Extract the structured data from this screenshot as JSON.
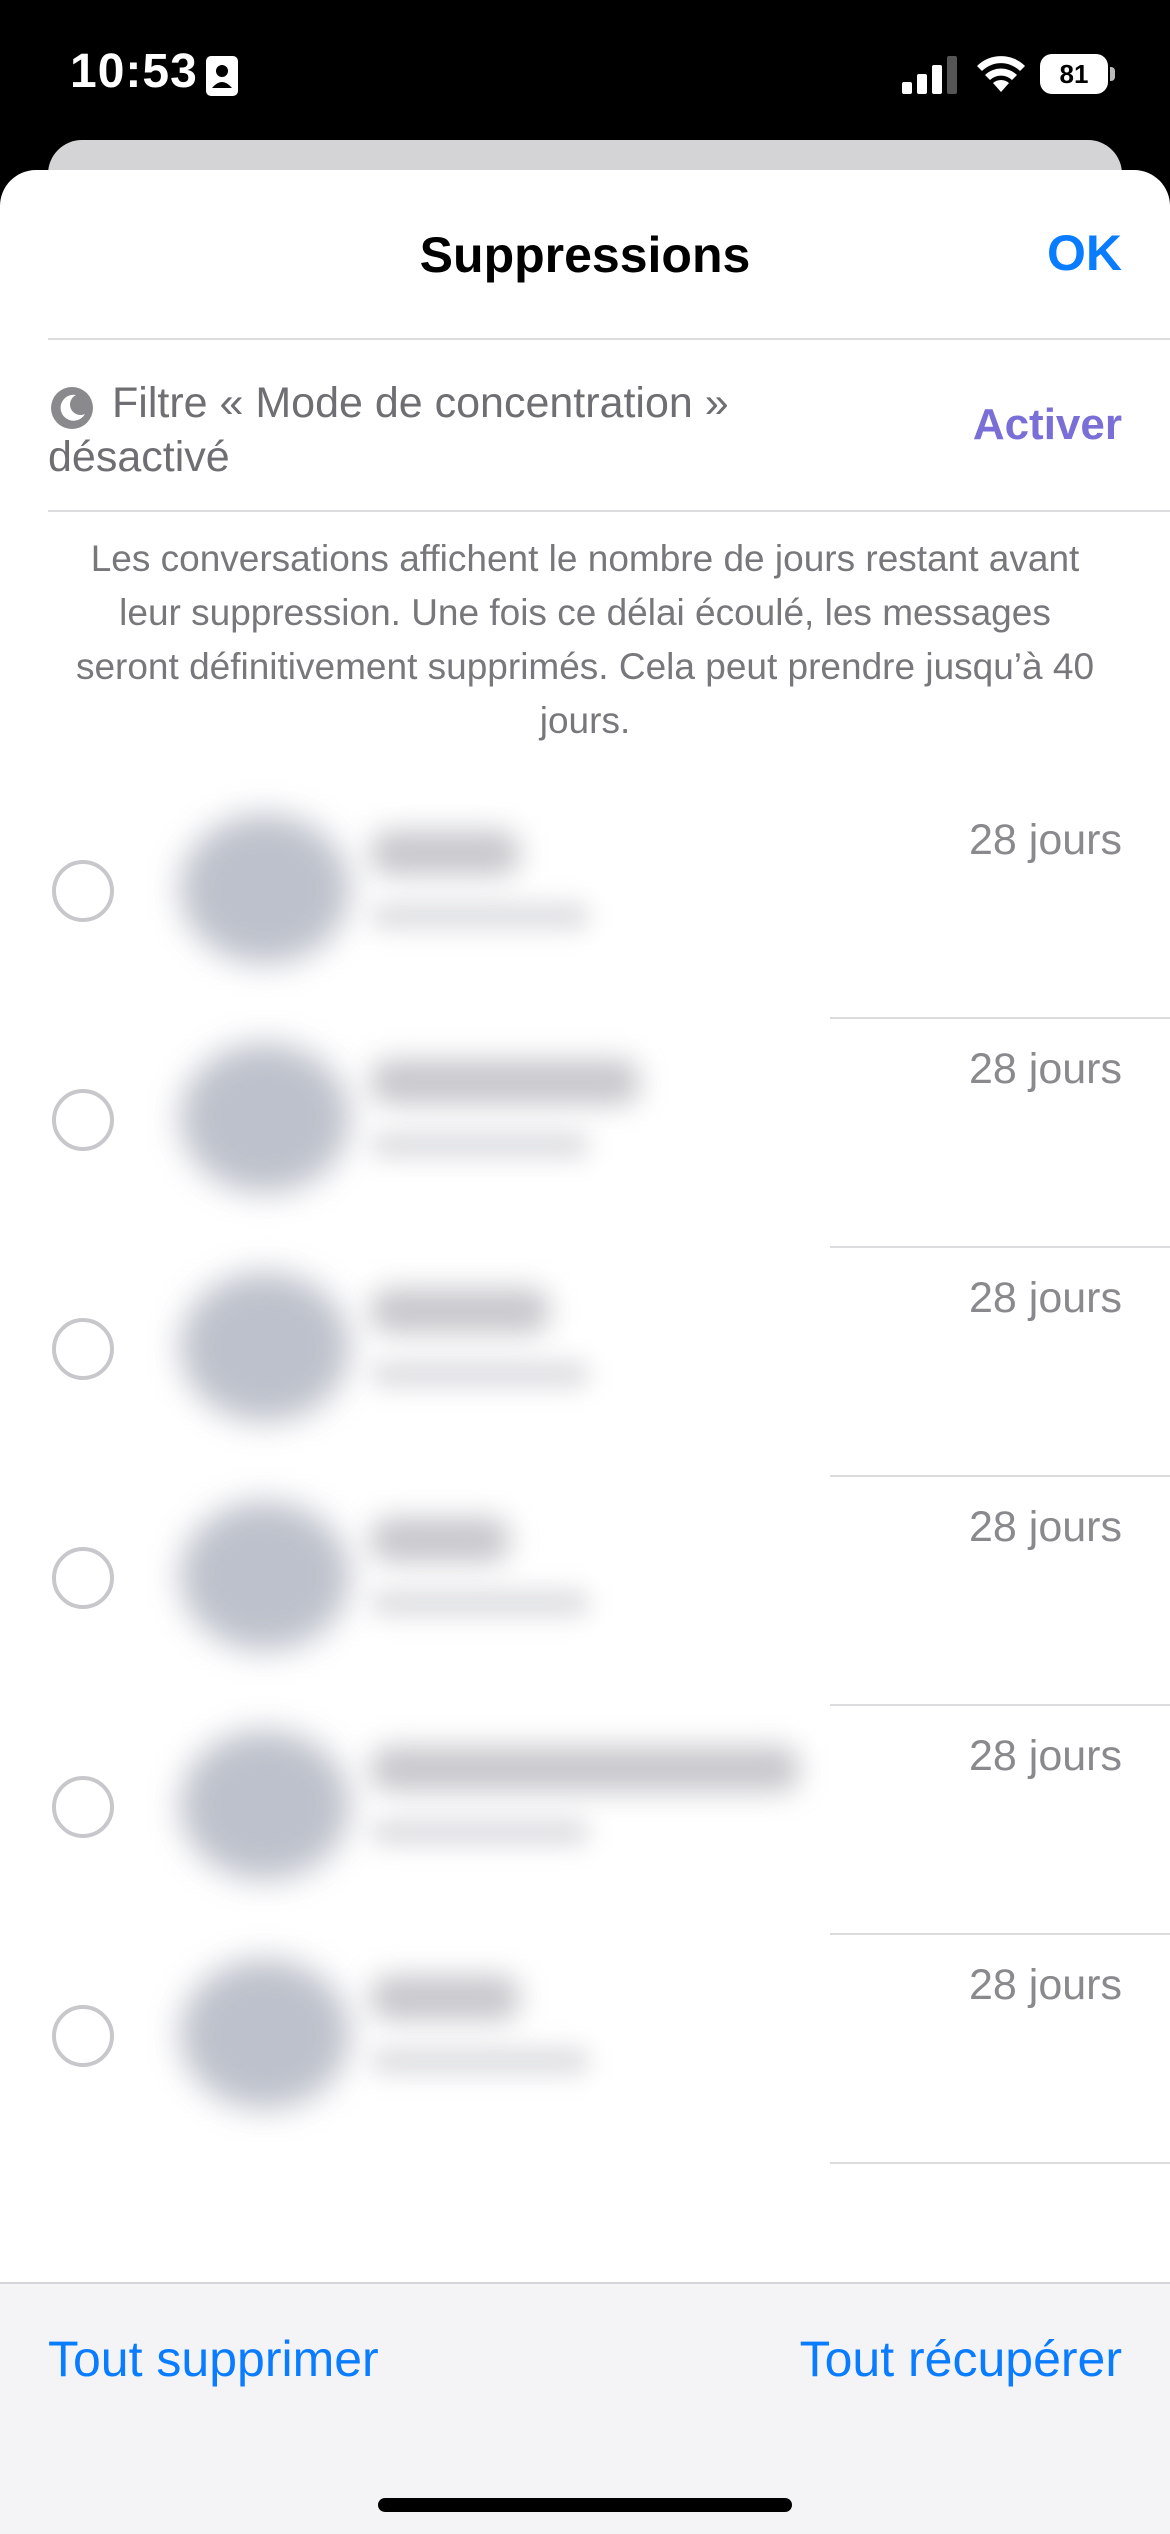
{
  "status_bar": {
    "time": "10:53",
    "battery": "81"
  },
  "sheet": {
    "title": "Suppressions",
    "ok_label": "OK"
  },
  "focus": {
    "text": "Filtre « Mode de concentration » désactivé",
    "activate_label": "Activer"
  },
  "info": {
    "text": "Les conversations affichent le nombre de jours restant avant leur suppression. Une fois ce délai écoulé, les messages seront définitivement supprimés. Cela peut prendre jusqu’à 40 jours."
  },
  "conversations": [
    {
      "days": "28 jours"
    },
    {
      "days": "28 jours"
    },
    {
      "days": "28 jours"
    },
    {
      "days": "28 jours"
    },
    {
      "days": "28 jours"
    },
    {
      "days": "28 jours"
    }
  ],
  "bottom_bar": {
    "delete_all_label": "Tout supprimer",
    "recover_all_label": "Tout récupérer"
  },
  "colors": {
    "accent": "#0a7cff",
    "focus_accent": "#7a6fd6",
    "secondary_text": "#77777c"
  }
}
